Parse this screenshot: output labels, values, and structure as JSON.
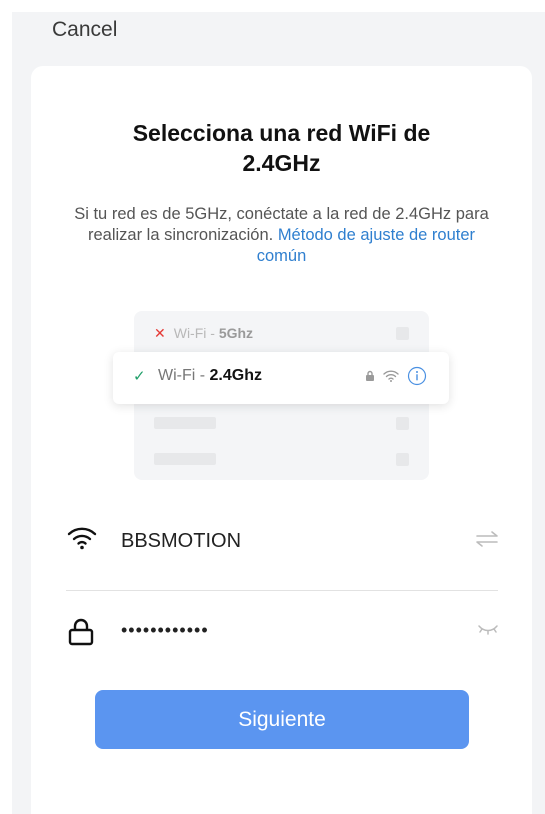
{
  "header": {
    "cancel_label": "Cancel"
  },
  "card": {
    "title": "Selecciona una red WiFi de 2.4GHz",
    "description_text": "Si tu red es de 5GHz, conéctate a la red de 2.4GHz para realizar la sincronización. ",
    "description_link": "Método de ajuste de router común"
  },
  "illustration": {
    "row_5g_prefix": "Wi-Fi - ",
    "row_5g_band": "5Ghz",
    "row_24g_prefix": "Wi-Fi - ",
    "row_24g_band": "2.4Ghz"
  },
  "wifi_field": {
    "ssid": "BBSMOTION",
    "icon": "wifi-icon",
    "switch_icon": "swap-icon"
  },
  "password_field": {
    "masked_value": "••••••••••••",
    "icon": "lock-icon",
    "toggle_icon": "eye-closed-icon"
  },
  "next_button": {
    "label": "Siguiente"
  },
  "colors": {
    "accent": "#5b95f0",
    "link": "#2f7fcf",
    "check": "#22a06b",
    "error": "#e53935"
  }
}
